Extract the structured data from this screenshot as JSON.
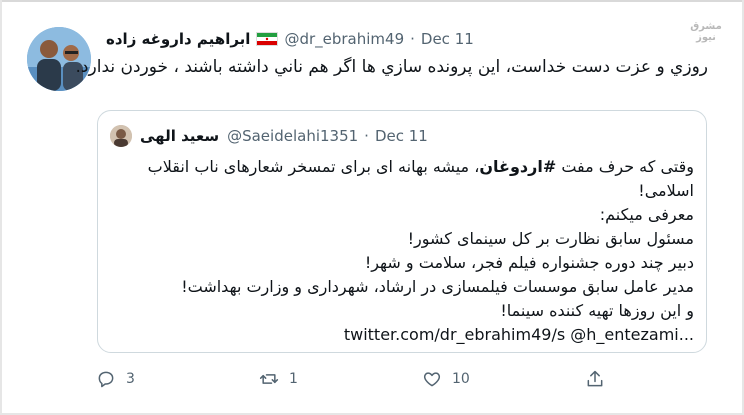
{
  "tweet": {
    "author_name": "ابراهیم داروغه زاده",
    "flag": "Iran",
    "handle": "@dr_ebrahim49",
    "separator": "·",
    "date": "Dec 11",
    "text": "روزي و عزت دست خداست، اين پرونده سازي ها اگر هم ناني داشته باشند ، خوردن ندارد."
  },
  "quoted_tweet": {
    "author_name": "سعید الهی",
    "handle": "@Saeidelahi1351",
    "separator": "·",
    "date": "Dec 11",
    "line1_before": "وقتی که حرف مفت ",
    "hashtag": "#اردوغان",
    "line1_after": "، میشه بهانه ای برای تمسخر شعارهای ناب انقلاب",
    "line2": "اسلامی!",
    "line3": "معرفی میکنم:",
    "line4": "مسئول سابق نظارت بر کل سینمای کشور!",
    "line5": "دبیر چند دوره جشنواره فیلم فجر، سلامت و شهر!",
    "line6": "مدیر عامل سابق موسسات فیلمسازی در ارشاد، شهرداری و وزارت بهداشت!",
    "line7": "و این روزها تهیه کننده سینما!",
    "line8": "twitter.com/dr_ebrahim49/s @h_entezami..."
  },
  "actions": {
    "reply_count": "3",
    "retweet_count": "1",
    "like_count": "10"
  },
  "watermark": {
    "line1": "مشرق",
    "line2": "نیوز"
  },
  "colors": {
    "text": "#0f1419",
    "secondary": "#536471",
    "border": "#cfd9de"
  }
}
